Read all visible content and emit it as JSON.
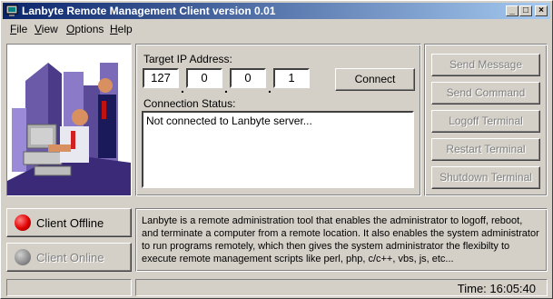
{
  "window": {
    "title": "Lanbyte Remote Management Client version 0.01"
  },
  "caption_buttons": {
    "minimize": "_",
    "maximize": "□",
    "close": "×"
  },
  "menu": [
    {
      "label": "File",
      "accel": "F",
      "rest": "ile"
    },
    {
      "label": "View",
      "accel": "V",
      "rest": "iew"
    },
    {
      "label": "Options",
      "accel": "O",
      "rest": "ptions"
    },
    {
      "label": "Help",
      "accel": "H",
      "rest": "elp"
    }
  ],
  "connection": {
    "ip_label": "Target IP Address:",
    "ip": [
      "127",
      "0",
      "0",
      "1"
    ],
    "connect_label": "Connect",
    "status_label": "Connection Status:",
    "status_text": "Not connected to Lanbyte server..."
  },
  "actions": [
    {
      "label": "Send Message"
    },
    {
      "label": "Send Command"
    },
    {
      "label": "Logoff Terminal"
    },
    {
      "label": "Restart Terminal"
    },
    {
      "label": "Shutdown Terminal"
    }
  ],
  "client_status": {
    "offline_label": "Client Offline",
    "online_label": "Client Online",
    "offline_color": "#e00000",
    "online_color": "#909090"
  },
  "description": "Lanbyte is a remote administration tool that enables the administrator to logoff, reboot, and terminate a computer from a remote location. It also enables the system administrator to run programs remotely, which then gives the system administrator the flexibilty to execute remote management scripts like perl, php, c/c++, vbs, js, etc...",
  "statusbar": {
    "time": "Time: 16:05:40"
  }
}
